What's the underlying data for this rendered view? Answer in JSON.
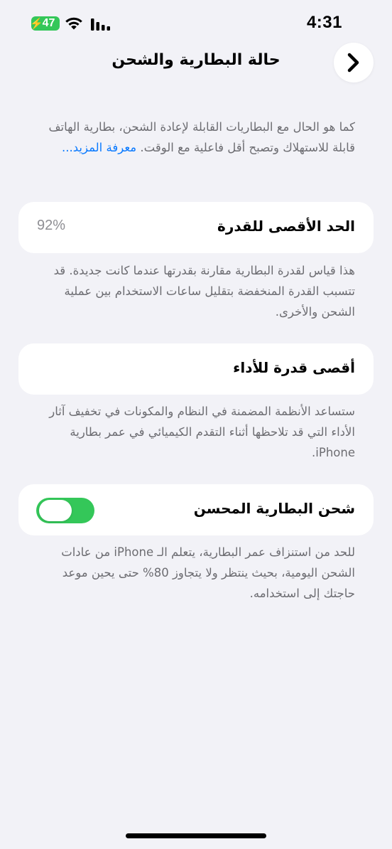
{
  "status_bar": {
    "time": "4:31",
    "battery_level": "47",
    "battery_color": "#34c759"
  },
  "nav": {
    "title": "حالة البطارية والشحن",
    "back_icon": "chevron-icon"
  },
  "intro": {
    "text": "كما هو الحال مع البطاريات القابلة لإعادة الشحن، بطارية الهاتف قابلة للاستهلاك وتصبح أقل فاعلية مع الوقت.",
    "link": "معرفة المزيد..."
  },
  "max_capacity": {
    "label": "الحد الأقصى للقدرة",
    "value": "92%",
    "description": "هذا قياس لقدرة البطارية مقارنة بقدرتها عندما كانت جديدة. قد تتسبب القدرة المنخفضة بتقليل ساعات الاستخدام بين عملية الشحن والأخرى."
  },
  "peak_performance": {
    "label": "أقصى قدرة للأداء",
    "description": "ستساعد الأنظمة المضمنة في النظام والمكونات في تخفيف آثار الأداء التي قد تلاحظها أثناء التقدم الكيميائي في عمر بطارية iPhone."
  },
  "optimized_charging": {
    "label": "شحن البطارية المحسن",
    "enabled": true,
    "description": "للحد من استنزاف عمر البطارية، يتعلم الـ iPhone من عادات الشحن اليومية، بحيث ينتظر ولا يتجاوز 80% حتى يحين موعد حاجتك إلى استخدامه."
  },
  "colors": {
    "background": "#f2f2f7",
    "accent_green": "#34c759",
    "link_blue": "#0a7aff",
    "secondary_text": "#6d6d72"
  }
}
